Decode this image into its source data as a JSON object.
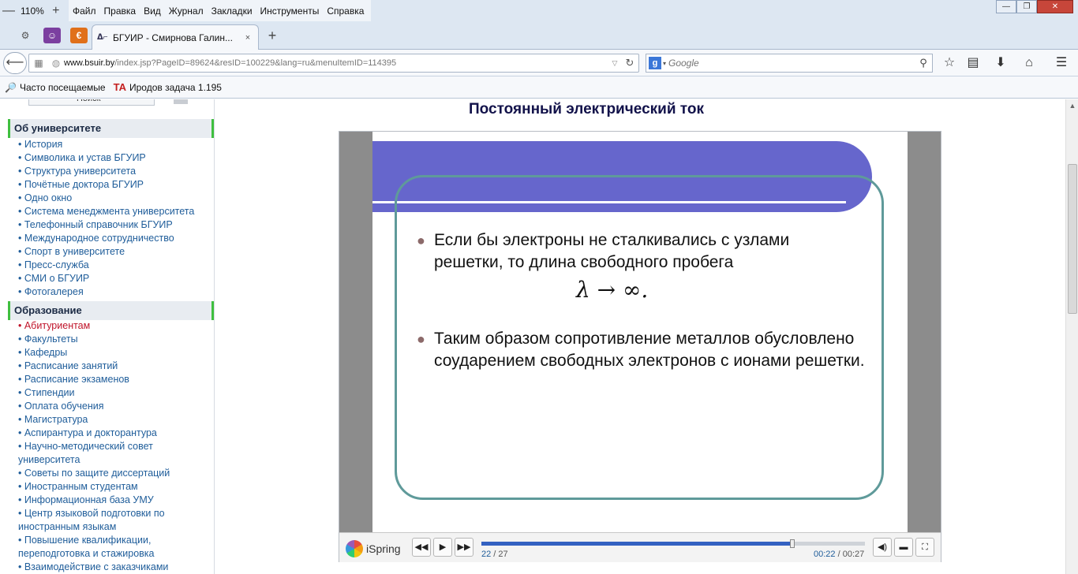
{
  "menubar": {
    "zoom_out": "—",
    "zoom_level": "110%",
    "zoom_in": "+",
    "items": [
      "Файл",
      "Правка",
      "Вид",
      "Журнал",
      "Закладки",
      "Инструменты",
      "Справка"
    ],
    "window_controls": {
      "minimize": "—",
      "restore": "❐",
      "close": "✕"
    }
  },
  "tabs": {
    "pinned": [
      {
        "icon": "gear-icon"
      },
      {
        "icon": "mask-icon"
      },
      {
        "icon": "euro-icon"
      }
    ],
    "active": {
      "title": "БГУИР - Смирнова Галин...",
      "close": "×"
    },
    "new_tab": "+"
  },
  "navigation": {
    "url_host": "www.bsuir.by",
    "url_path": "/index.jsp?PageID=89624&resID=100229&lang=ru&menuItemID=114395",
    "search_placeholder": "Google",
    "search_engine": "g"
  },
  "bookmarks": [
    {
      "label": "Часто посещаемые",
      "icon": "frequent-icon"
    },
    {
      "label": "Иродов задача 1.195",
      "icon": "ta-icon"
    }
  ],
  "sidebar": {
    "search_label": "Поиск",
    "sections": [
      {
        "title": "Об университете",
        "items": [
          "• История",
          "• Символика и устав БГУИР",
          "• Структура университета",
          "• Почётные доктора БГУИР",
          "• Одно окно",
          "• Система менеджмента университета",
          "• Телефонный справочник БГУИР",
          "• Международное сотрудничество",
          "• Спорт в университете",
          "• Пресс-служба",
          "• СМИ о БГУИР",
          "• Фотогалерея"
        ]
      },
      {
        "title": "Образование",
        "items": [
          "• Абитуриентам",
          "• Факультеты",
          "• Кафедры",
          "• Расписание занятий",
          "• Расписание экзаменов",
          "• Стипендии",
          "• Оплата обучения",
          "• Магистратура",
          "• Аспирантура и докторантура",
          "• Научно-методический совет университета",
          "• Советы по защите диссертаций",
          "• Иностранным студентам",
          "• Информационная база УМУ",
          "• Центр языковой подготовки по иностранным языкам",
          "• Повышение квалификации, переподготовка и стажировка",
          "• Взаимодействие с заказчиками"
        ],
        "active_item": "• Абитуриентам"
      }
    ]
  },
  "main": {
    "title": "Постоянный электрический ток"
  },
  "slide": {
    "bullet1": "Если бы электроны не сталкивались с узлами решетки, то длина свободного пробега",
    "formula": "λ → ∞.",
    "bullet2": "Таким образом сопротивление металлов обусловлено соударением свободных электронов с ионами решетки."
  },
  "player": {
    "brand": "iSpring",
    "current_slide": "22",
    "slide_separator": " / ",
    "total_slides": "27",
    "current_time": "00:22",
    "total_time": "00:27",
    "progress_fraction": 0.81
  }
}
